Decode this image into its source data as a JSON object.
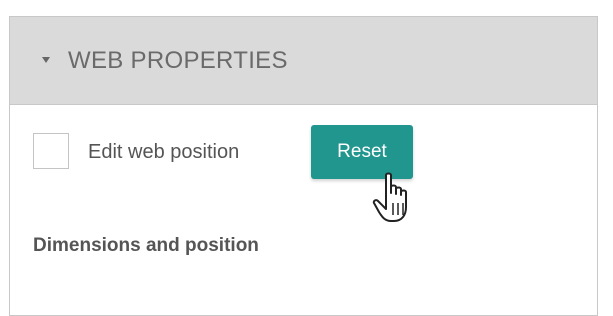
{
  "panel": {
    "header": {
      "title": "WEB PROPERTIES",
      "expanded": true,
      "toggle_icon": "caret-down-icon"
    },
    "edit_web_position": {
      "label": "Edit web position",
      "checked": false
    },
    "reset_button": {
      "label": "Reset",
      "color": "#21968e"
    },
    "section": {
      "heading": "Dimensions and position"
    }
  },
  "cursor": {
    "icon": "hand-pointer-icon"
  }
}
